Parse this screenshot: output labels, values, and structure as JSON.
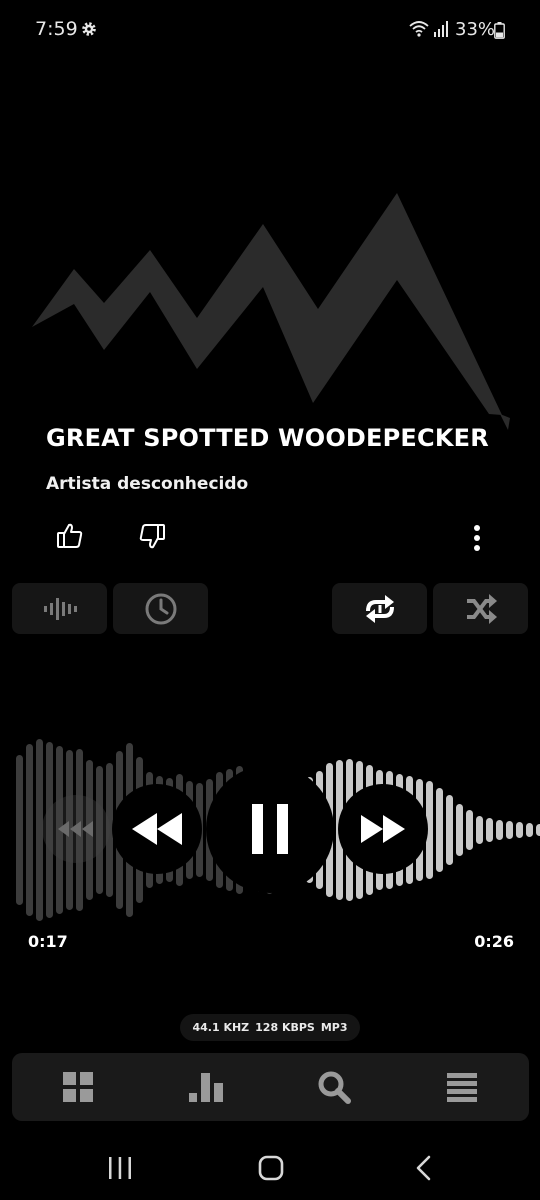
{
  "status_bar": {
    "time": "7:59",
    "battery": "33%",
    "icons": [
      "gear-icon",
      "wifi-icon",
      "signal-icon",
      "battery-icon"
    ]
  },
  "now_playing": {
    "title": "GREAT SPOTTED WOODEPECKER",
    "artist": "Artista desconhecido",
    "album_art": "mountain-peaks-graphic"
  },
  "actions": {
    "like_icon": "thumbs-up-icon",
    "dislike_icon": "thumbs-down-icon",
    "more_icon": "more-vertical-icon"
  },
  "tools": [
    "visualizer-icon",
    "sleep-timer-icon",
    "repeat-one-icon",
    "shuffle-icon"
  ],
  "playback": {
    "elapsed": "0:17",
    "total": "0:26",
    "progress": 0.654,
    "state": "playing"
  },
  "audio_info": {
    "sample_rate": "44.1 KHZ",
    "bitrate": "128 KBPS",
    "format": "MP3"
  },
  "bottom_nav": [
    "library-grid-icon",
    "stats-icon",
    "search-icon",
    "queue-icon"
  ],
  "system_nav": [
    "recents-icon",
    "home-icon",
    "back-icon"
  ],
  "colors": {
    "background": "#000000",
    "tile": "#161616",
    "nav_bar": "#1a1a1a",
    "icon": "#9a9a9a",
    "played_wave": "#3c3c3c",
    "unplayed_wave": "#c8c8c8"
  }
}
